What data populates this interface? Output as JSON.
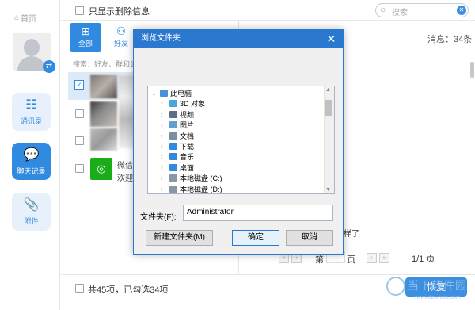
{
  "rail": {
    "home_label": "首页",
    "items": [
      {
        "label": "通讯录",
        "icon": "contacts-icon"
      },
      {
        "label": "聊天记录",
        "icon": "chat-icon"
      },
      {
        "label": "附件",
        "icon": "paperclip-icon"
      }
    ]
  },
  "topbar": {
    "show_deleted_label": "只显示删除信息",
    "search_placeholder": "搜索"
  },
  "list": {
    "tabs": [
      {
        "label": "全部"
      },
      {
        "label": "好友"
      }
    ],
    "search_hint": "搜索：好友、群和公众号",
    "rows": [
      {
        "name": "微信团队",
        "preview": "欢迎使用"
      }
    ]
  },
  "messages": {
    "count_text": "消息：34条",
    "partial_text": "样了"
  },
  "pager": {
    "label_before": "第",
    "label_after": "页",
    "total": "1/1 页"
  },
  "bottom": {
    "selection_text": "共45项，已勾选34项",
    "restore_label": "恢复",
    "watermark_text": "当下软件园",
    "watermark_sub": "www.downxia.com"
  },
  "dialog": {
    "title": "浏览文件夹",
    "tree": [
      {
        "label": "此电脑",
        "icon": "pc-icon",
        "arrow": "⌄",
        "indent": 0
      },
      {
        "label": "3D 对象",
        "icon": "3d-objects-icon",
        "arrow": "›",
        "indent": 1
      },
      {
        "label": "视频",
        "icon": "video-folder-icon",
        "arrow": "›",
        "indent": 1
      },
      {
        "label": "图片",
        "icon": "pictures-folder-icon",
        "arrow": "›",
        "indent": 1
      },
      {
        "label": "文档",
        "icon": "documents-folder-icon",
        "arrow": "›",
        "indent": 1
      },
      {
        "label": "下载",
        "icon": "downloads-folder-icon",
        "arrow": "›",
        "indent": 1
      },
      {
        "label": "音乐",
        "icon": "music-folder-icon",
        "arrow": "›",
        "indent": 1
      },
      {
        "label": "桌面",
        "icon": "desktop-folder-icon",
        "arrow": "›",
        "indent": 1
      },
      {
        "label": "本地磁盘 (C:)",
        "icon": "drive-icon",
        "arrow": "›",
        "indent": 1
      },
      {
        "label": "本地磁盘 (D:)",
        "icon": "drive-icon",
        "arrow": "›",
        "indent": 1
      }
    ],
    "folder_label": "文件夹(F):",
    "folder_value": "Administrator",
    "new_folder_label": "新建文件夹(M)",
    "ok_label": "确定",
    "cancel_label": "取消"
  },
  "colors": {
    "accent": "#2f8ae0",
    "dialog_title": "#2b78d0"
  }
}
